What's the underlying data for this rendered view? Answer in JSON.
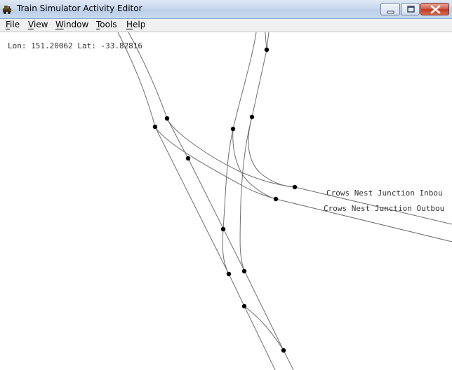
{
  "window": {
    "title": "Train Simulator Activity Editor",
    "icon": "locomotive-icon"
  },
  "menu": {
    "items": [
      {
        "first": "F",
        "rest": "ile"
      },
      {
        "first": "V",
        "rest": "iew"
      },
      {
        "first": "W",
        "rest": "indow"
      },
      {
        "first": "T",
        "rest": "ools"
      },
      {
        "first": "H",
        "rest": "elp"
      }
    ]
  },
  "map": {
    "coordinates": "Lon: 151.20062 Lat: -33.82816",
    "labels": [
      "Crows Nest Junction Inbou",
      "Crows Nest Junction Outbou"
    ]
  },
  "colors": {
    "track": "#6e6e6e",
    "node": "#000000",
    "background": "#ffffff"
  }
}
